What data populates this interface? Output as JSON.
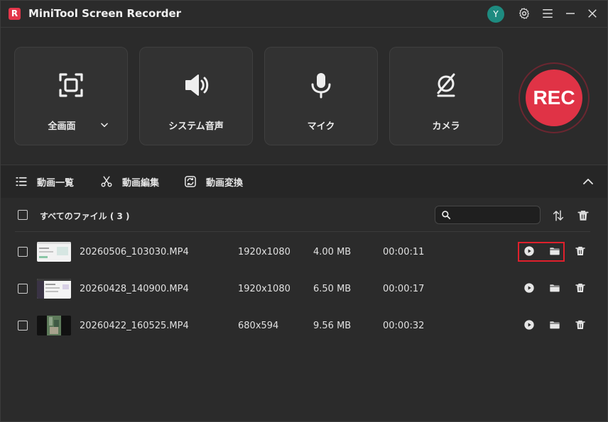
{
  "app": {
    "logo": "R",
    "title": "MiniTool Screen Recorder",
    "avatar_letter": "Y"
  },
  "sources": [
    {
      "label": "全画面",
      "icon": "fullscreen-icon"
    },
    {
      "label": "システム音声",
      "icon": "speaker-icon"
    },
    {
      "label": "マイク",
      "icon": "microphone-icon"
    },
    {
      "label": "カメラ",
      "icon": "camera-off-icon"
    }
  ],
  "rec_label": "REC",
  "tabs": [
    {
      "label": "動画一覧",
      "icon": "list-icon"
    },
    {
      "label": "動画編集",
      "icon": "scissors-icon"
    },
    {
      "label": "動画変換",
      "icon": "convert-icon"
    }
  ],
  "list": {
    "all_files_label": "すべてのファイル ( 3 )",
    "search_placeholder": "",
    "rows": [
      {
        "name": "20260506_103030.MP4",
        "resolution": "1920x1080",
        "size": "4.00 MB",
        "duration": "00:00:11"
      },
      {
        "name": "20260428_140900.MP4",
        "resolution": "1920x1080",
        "size": "6.50 MB",
        "duration": "00:00:17"
      },
      {
        "name": "20260422_160525.MP4",
        "resolution": "680x594",
        "size": "9.56 MB",
        "duration": "00:00:32"
      }
    ]
  },
  "colors": {
    "accent": "#e03346",
    "background": "#2b2b2b",
    "card": "#323232",
    "highlight": "#e0202c",
    "avatar": "#1e8b80"
  }
}
